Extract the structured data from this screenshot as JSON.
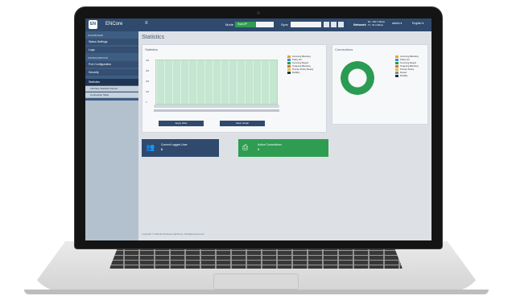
{
  "colors": {
    "header_bg": "#2f4a6d",
    "sidebar_top_bg": "#3e5d83",
    "sidebar_bg": "#b3c1cf",
    "accent_green": "#2a9b52",
    "tile_blue": "#2f4a6d",
    "tile_green": "#2e9d52"
  },
  "header": {
    "logo": "EN",
    "app_name": "ENCore",
    "menu_icon": "≡",
    "mode_label": "Mode",
    "mode_value": "Sync/IP",
    "sync_label": "Sync",
    "network_label": "Network",
    "net_stats": [
      "Rx: 100.1 Mbps",
      "Tx: 30.4 Mbps"
    ],
    "admin_button": "admin ▾",
    "language_button": "English ▾"
  },
  "sidebar": {
    "section_1": "DASHBOARD",
    "items": [
      "Status Settings",
      "Logs"
    ],
    "section_2": "CONFIGURATION",
    "config_items": [
      "Port Configuration",
      "Security"
    ],
    "selected_item": "Statistics",
    "sub_items": [
      "Interface Statistics Report",
      "Connection Table"
    ]
  },
  "main": {
    "page_title": "Statistics",
    "stats_panel": {
      "title": "Statistics",
      "y_ticks": [
        "400",
        "300",
        "200",
        "100",
        "0"
      ],
      "legend": [
        {
          "label": "Incoming Blocking",
          "color": "#f0a030"
        },
        {
          "label": "Policy Hit",
          "color": "#3a8fd0"
        },
        {
          "label": "Incoming Reject",
          "color": "#2a9b52"
        },
        {
          "label": "Outgoing Blocking",
          "color": "#e07030"
        },
        {
          "label": "Prompt Policy Ready",
          "color": "#d0c040"
        },
        {
          "label": "Mobility",
          "color": "#203050"
        }
      ],
      "buttons": [
        "Apply Filter",
        "Clear Graph"
      ]
    },
    "connections_panel": {
      "title": "Connections",
      "legend": [
        {
          "label": "Incoming Blocking",
          "color": "#f0a030"
        },
        {
          "label": "Policy Hit",
          "color": "#3a8fd0"
        },
        {
          "label": "Incoming Reject",
          "color": "#2a9b52"
        },
        {
          "label": "Outgoing Blocking",
          "color": "#e07030"
        },
        {
          "label": "Prompt Policy",
          "color": "#d0c040"
        },
        {
          "label": "Router",
          "color": "#808890"
        },
        {
          "label": "Mobility",
          "color": "#203050"
        }
      ]
    },
    "tiles": [
      {
        "label": "Current Logged User",
        "value": "6",
        "icon": "users-icon"
      },
      {
        "label": "Active Connections",
        "value": "3",
        "icon": "cast-icon"
      }
    ],
    "footer": "Copyright © 2019 EN Networks (ENCore). All Rights Reserved."
  }
}
